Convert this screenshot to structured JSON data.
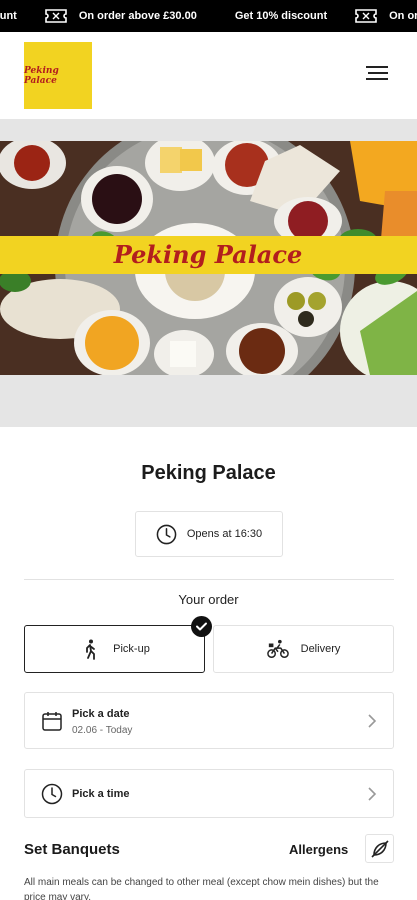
{
  "promo_ticker": {
    "items": [
      "ount",
      "On order above £30.00",
      "Get 10% discount",
      "On order"
    ]
  },
  "header": {
    "logo_text": "Peking Palace",
    "menu_icon": "hamburger-icon",
    "logo_color": "#f2d321"
  },
  "hero": {
    "banner_text": "Peking Palace",
    "banner_color": "#f2d321",
    "banner_text_color": "#b21e1e"
  },
  "restaurant": {
    "name": "Peking Palace",
    "hours": "Opens at 16:30",
    "hours_icon": "clock-icon"
  },
  "order": {
    "label": "Your order",
    "options": [
      {
        "label": "Pick-up",
        "icon": "walking-person-icon",
        "selected": true
      },
      {
        "label": "Delivery",
        "icon": "cyclist-icon",
        "selected": false
      }
    ],
    "date_picker": {
      "label": "Pick a date",
      "value": "02.06 - Today",
      "icon": "calendar-icon"
    },
    "time_picker": {
      "label": "Pick a time",
      "icon": "clock-icon"
    }
  },
  "menu_section": {
    "title": "Set Banquets",
    "allergens_label": "Allergens",
    "allergens_icon": "no-allergen-icon",
    "description": "All main meals can be changed to other meal (except chow mein dishes) but the price may vary."
  }
}
